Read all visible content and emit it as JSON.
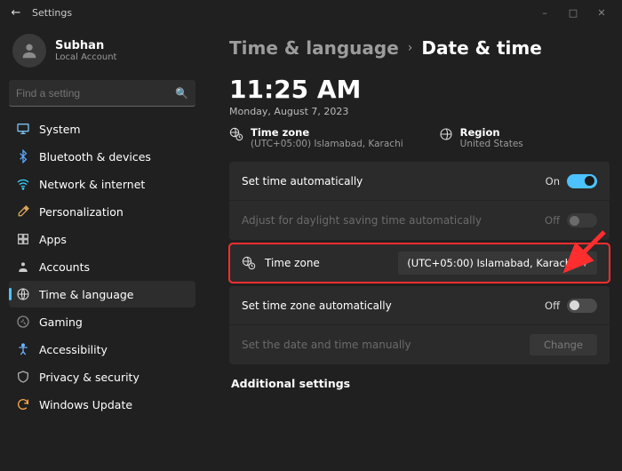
{
  "window": {
    "title": "Settings"
  },
  "user": {
    "name": "Subhan",
    "subtitle": "Local Account"
  },
  "search": {
    "placeholder": "Find a setting"
  },
  "sidebar": {
    "items": [
      {
        "label": "System"
      },
      {
        "label": "Bluetooth & devices"
      },
      {
        "label": "Network & internet"
      },
      {
        "label": "Personalization"
      },
      {
        "label": "Apps"
      },
      {
        "label": "Accounts"
      },
      {
        "label": "Time & language"
      },
      {
        "label": "Gaming"
      },
      {
        "label": "Accessibility"
      },
      {
        "label": "Privacy & security"
      },
      {
        "label": "Windows Update"
      }
    ]
  },
  "breadcrumb": {
    "root": "Time & language",
    "leaf": "Date & time"
  },
  "clock": {
    "time": "11:25 AM",
    "date": "Monday, August 7, 2023"
  },
  "info": {
    "tz_label": "Time zone",
    "tz_value": "(UTC+05:00) Islamabad, Karachi",
    "region_label": "Region",
    "region_value": "United States"
  },
  "rows": {
    "auto_time": {
      "label": "Set time automatically",
      "state": "On"
    },
    "dst": {
      "label": "Adjust for daylight saving time automatically",
      "state": "Off"
    },
    "tz": {
      "label": "Time zone",
      "value": "(UTC+05:00) Islamabad, Karachi"
    },
    "auto_tz": {
      "label": "Set time zone automatically",
      "state": "Off"
    },
    "manual": {
      "label": "Set the date and time manually",
      "button": "Change"
    }
  },
  "section": {
    "additional": "Additional settings"
  }
}
